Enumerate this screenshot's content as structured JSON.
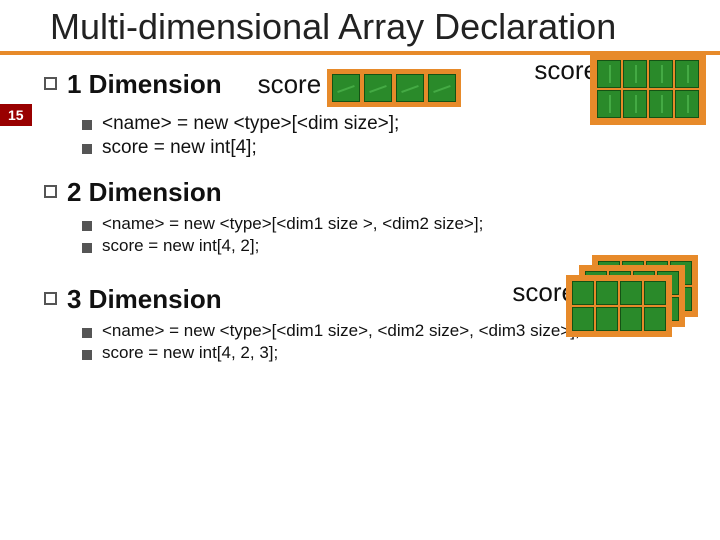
{
  "page_number": "15",
  "title": "Multi-dimensional Array Declaration",
  "label_score_1d": "score",
  "label_score_2d": "score",
  "label_score_3d": "score",
  "sections": {
    "dim1": {
      "heading": "1 Dimension",
      "line1": "<name> = new <type>[<dim size>];",
      "line2": "score = new int[4];"
    },
    "dim2": {
      "heading": "2 Dimension",
      "line1": "<name> = new <type>[<dim1 size >, <dim2 size>];",
      "line2": "score = new int[4, 2];"
    },
    "dim3": {
      "heading": "3 Dimension",
      "line1": "<name> = new <type>[<dim1 size>, <dim2 size>, <dim3 size>];",
      "line2": "score = new int[4, 2, 3];"
    }
  }
}
